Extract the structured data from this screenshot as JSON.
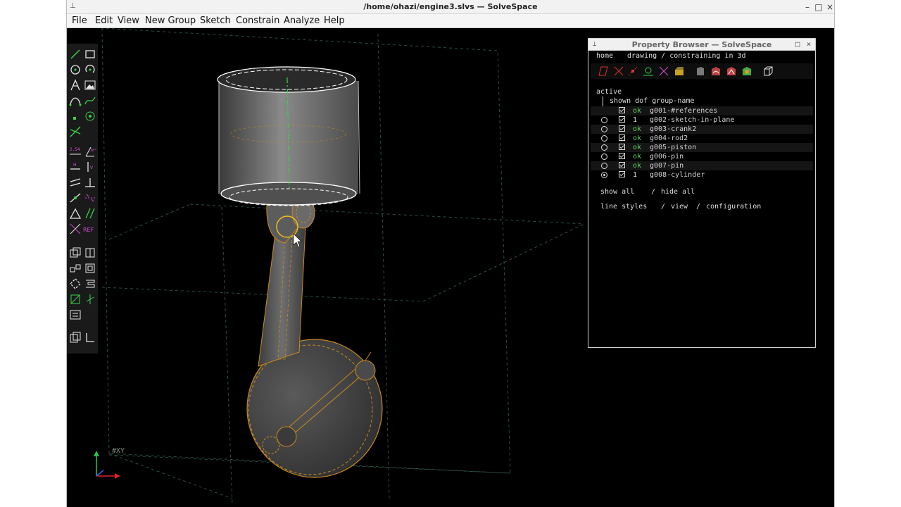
{
  "window": {
    "title": "/home/ohazi/engine3.slvs — SolveSpace",
    "minimize": "–",
    "maximize": "□",
    "close": "×"
  },
  "menu": [
    "File",
    "Edit",
    "View",
    "New Group",
    "Sketch",
    "Constrain",
    "Analyze",
    "Help"
  ],
  "viewport": {
    "workplane_label": "#XY",
    "accent_color": "#c98a1f",
    "highlight_color": "#f0c020"
  },
  "toolbar_icons": [
    "line-icon",
    "rectangle-icon",
    "circle-icon",
    "arc-icon",
    "text-icon",
    "image-icon",
    "bezier-icon",
    "spline-icon",
    "point-icon",
    "construction-point-icon",
    "split-curves-icon",
    "distance-constraint-icon",
    "angle-constraint-icon",
    "horizontal-constraint-icon",
    "vertical-constraint-icon",
    "parallel-constraint-icon",
    "perpendicular-constraint-icon",
    "point-on-line-icon",
    "symmetric-icon",
    "equal-length-icon",
    "other-angle-icon",
    "nearest-ortho-icon",
    "reference-icon",
    "sketch-in-3d-icon",
    "sketch-in-plane-icon",
    "step-translating-icon",
    "step-rotating-icon",
    "extrude-icon",
    "lathe-icon",
    "helix-icon",
    "revolve-icon",
    "link-icon",
    "in-workplane-icon",
    "free-in-3d-icon"
  ],
  "property_browser": {
    "title": "Property Browser — SolveSpace",
    "nav_home": "home",
    "nav_status": "drawing / constraining in 3d",
    "active_label": "active",
    "header": "shown dof group-name",
    "groups": [
      {
        "active": false,
        "has_radio": false,
        "shown": true,
        "dof": "ok",
        "name": "g001-#references"
      },
      {
        "active": false,
        "has_radio": true,
        "shown": true,
        "dof": "1",
        "name": "g002-sketch-in-plane"
      },
      {
        "active": false,
        "has_radio": true,
        "shown": true,
        "dof": "ok",
        "name": "g003-crank2"
      },
      {
        "active": false,
        "has_radio": true,
        "shown": true,
        "dof": "ok",
        "name": "g004-rod2"
      },
      {
        "active": false,
        "has_radio": true,
        "shown": true,
        "dof": "ok",
        "name": "g005-piston"
      },
      {
        "active": false,
        "has_radio": true,
        "shown": true,
        "dof": "ok",
        "name": "g006-pin"
      },
      {
        "active": false,
        "has_radio": true,
        "shown": true,
        "dof": "ok",
        "name": "g007-pin"
      },
      {
        "active": true,
        "has_radio": true,
        "shown": true,
        "dof": "1",
        "name": "g008-cylinder"
      }
    ],
    "show_all": "show all",
    "sep1": "/",
    "hide_all": "hide all",
    "line_styles": "line styles",
    "sep2": "/",
    "view": "view",
    "sep3": "/",
    "configuration": "configuration"
  }
}
